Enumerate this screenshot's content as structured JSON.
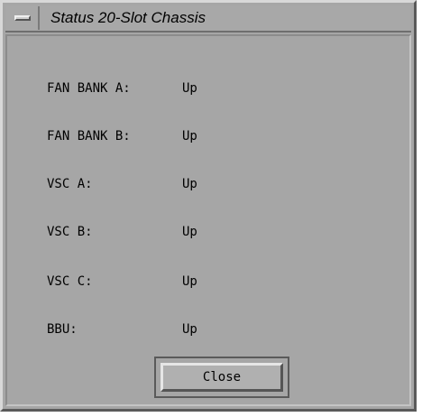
{
  "window": {
    "title": "Status 20-Slot Chassis"
  },
  "status": {
    "rows": [
      {
        "label": "FAN BANK A:",
        "value": "Up"
      },
      {
        "label": "FAN BANK B:",
        "value": "Up"
      },
      {
        "label": "VSC A:",
        "value": "Up"
      },
      {
        "label": "VSC B:",
        "value": "Up"
      },
      {
        "label": "VSC C:",
        "value": "Up"
      },
      {
        "label": "BBU:",
        "value": "Up"
      }
    ]
  },
  "buttons": {
    "close_label": "Close"
  },
  "icons": {
    "window_menu": "window-menu-icon"
  }
}
